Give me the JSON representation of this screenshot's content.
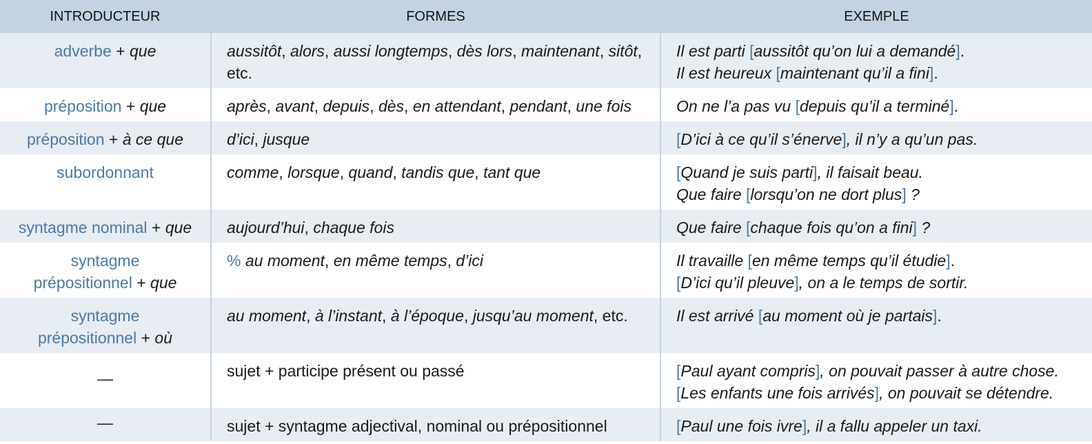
{
  "headers": [
    "INTRODUCTEUR",
    "FORMES",
    "EXEMPLE"
  ],
  "colors": {
    "accent": "#4a7aa4",
    "header_bg": "#c3d3e1",
    "row_alt_bg": "#e8edf3"
  },
  "rows": [
    {
      "intro": [
        {
          "t": "adverbe",
          "c": "blue"
        },
        {
          "t": " + ",
          "c": ""
        },
        {
          "t": "que",
          "c": "it"
        }
      ],
      "forms": [
        {
          "t": "aussitôt",
          "c": "it"
        },
        {
          "t": ", ",
          "c": ""
        },
        {
          "t": "alors",
          "c": "it"
        },
        {
          "t": ", ",
          "c": ""
        },
        {
          "t": "aussi longtemps",
          "c": "it"
        },
        {
          "t": ", ",
          "c": ""
        },
        {
          "t": "dès lors",
          "c": "it"
        },
        {
          "t": ", ",
          "c": ""
        },
        {
          "t": "maintenant",
          "c": "it"
        },
        {
          "t": ", ",
          "c": ""
        },
        {
          "t": "sitôt",
          "c": "it"
        },
        {
          "t": ", etc.",
          "c": ""
        }
      ],
      "examples": [
        [
          {
            "t": "Il est parti ",
            "c": "it"
          },
          {
            "t": "[",
            "c": "blue"
          },
          {
            "t": "aussitôt qu’on lui a demandé",
            "c": "it"
          },
          {
            "t": "]",
            "c": "blue"
          },
          {
            "t": ".",
            "c": ""
          }
        ],
        [
          {
            "t": "Il est heureux ",
            "c": "it"
          },
          {
            "t": "[",
            "c": "blue"
          },
          {
            "t": "maintenant qu’il a fini",
            "c": "it"
          },
          {
            "t": "]",
            "c": "blue"
          },
          {
            "t": ".",
            "c": ""
          }
        ]
      ],
      "alt": true
    },
    {
      "intro": [
        {
          "t": "préposition",
          "c": "blue"
        },
        {
          "t": " + ",
          "c": ""
        },
        {
          "t": "que",
          "c": "it"
        }
      ],
      "forms": [
        {
          "t": "après",
          "c": "it"
        },
        {
          "t": ", ",
          "c": ""
        },
        {
          "t": "avant",
          "c": "it"
        },
        {
          "t": ", ",
          "c": ""
        },
        {
          "t": "depuis",
          "c": "it"
        },
        {
          "t": ", ",
          "c": ""
        },
        {
          "t": "dès",
          "c": "it"
        },
        {
          "t": ", ",
          "c": ""
        },
        {
          "t": "en attendant",
          "c": "it"
        },
        {
          "t": ", ",
          "c": ""
        },
        {
          "t": "pendant",
          "c": "it"
        },
        {
          "t": ", ",
          "c": ""
        },
        {
          "t": "une fois",
          "c": "it"
        }
      ],
      "examples": [
        [
          {
            "t": "On ne l’a pas vu ",
            "c": "it"
          },
          {
            "t": "[",
            "c": "blue"
          },
          {
            "t": "depuis qu’il a terminé",
            "c": "it"
          },
          {
            "t": "]",
            "c": "blue"
          },
          {
            "t": ".",
            "c": ""
          }
        ]
      ],
      "alt": false
    },
    {
      "intro": [
        {
          "t": "préposition",
          "c": "blue"
        },
        {
          "t": " + ",
          "c": ""
        },
        {
          "t": "à ce que",
          "c": "it"
        }
      ],
      "forms": [
        {
          "t": "d’ici",
          "c": "it"
        },
        {
          "t": ", ",
          "c": ""
        },
        {
          "t": "jusque",
          "c": "it"
        }
      ],
      "examples": [
        [
          {
            "t": "[",
            "c": "blue"
          },
          {
            "t": "D’ici à ce qu’il s’énerve",
            "c": "it"
          },
          {
            "t": "]",
            "c": "blue"
          },
          {
            "t": ", il n’y a qu’un pas.",
            "c": "it"
          }
        ]
      ],
      "alt": true
    },
    {
      "intro": [
        {
          "t": "subordonnant",
          "c": "blue"
        }
      ],
      "forms": [
        {
          "t": "comme",
          "c": "it"
        },
        {
          "t": ", ",
          "c": ""
        },
        {
          "t": "lorsque",
          "c": "it"
        },
        {
          "t": ", ",
          "c": ""
        },
        {
          "t": "quand",
          "c": "it"
        },
        {
          "t": ", ",
          "c": ""
        },
        {
          "t": "tandis que",
          "c": "it"
        },
        {
          "t": ", ",
          "c": ""
        },
        {
          "t": "tant que",
          "c": "it"
        }
      ],
      "examples": [
        [
          {
            "t": "[",
            "c": "blue"
          },
          {
            "t": "Quand je suis parti",
            "c": "it"
          },
          {
            "t": "]",
            "c": "blue"
          },
          {
            "t": ", il faisait beau.",
            "c": "it"
          }
        ],
        [
          {
            "t": "Que faire ",
            "c": "it"
          },
          {
            "t": "[",
            "c": "blue"
          },
          {
            "t": "lorsqu’on ne dort plus",
            "c": "it"
          },
          {
            "t": "]",
            "c": "blue"
          },
          {
            "t": " ?",
            "c": "it"
          }
        ]
      ],
      "alt": false
    },
    {
      "intro": [
        {
          "t": "syntagme nominal",
          "c": "blue"
        },
        {
          "t": " + ",
          "c": ""
        },
        {
          "t": "que",
          "c": "it"
        }
      ],
      "forms": [
        {
          "t": "aujourd’hui",
          "c": "it"
        },
        {
          "t": ", ",
          "c": ""
        },
        {
          "t": "chaque fois",
          "c": "it"
        }
      ],
      "examples": [
        [
          {
            "t": "Que faire ",
            "c": "it"
          },
          {
            "t": "[",
            "c": "blue"
          },
          {
            "t": "chaque fois qu’on a fini",
            "c": "it"
          },
          {
            "t": "]",
            "c": "blue"
          },
          {
            "t": " ?",
            "c": "it"
          }
        ]
      ],
      "alt": true
    },
    {
      "intro": [
        {
          "t": "syntagme",
          "c": "blue",
          "br": true
        },
        {
          "t": "prépositionnel",
          "c": "blue"
        },
        {
          "t": " + ",
          "c": ""
        },
        {
          "t": "que",
          "c": "it"
        }
      ],
      "forms": [
        {
          "t": "%",
          "c": "blue"
        },
        {
          "t": " ",
          "c": ""
        },
        {
          "t": "au moment",
          "c": "it"
        },
        {
          "t": ", ",
          "c": ""
        },
        {
          "t": "en même temps",
          "c": "it"
        },
        {
          "t": ", ",
          "c": ""
        },
        {
          "t": "d’ici",
          "c": "it"
        }
      ],
      "examples": [
        [
          {
            "t": "Il travaille ",
            "c": "it"
          },
          {
            "t": "[",
            "c": "blue"
          },
          {
            "t": "en même temps qu’il étudie",
            "c": "it"
          },
          {
            "t": "]",
            "c": "blue"
          },
          {
            "t": ".",
            "c": ""
          }
        ],
        [
          {
            "t": "[",
            "c": "blue"
          },
          {
            "t": "D’ici qu’il pleuve",
            "c": "it"
          },
          {
            "t": "]",
            "c": "blue"
          },
          {
            "t": ", on a le temps de sortir.",
            "c": "it"
          }
        ]
      ],
      "alt": false
    },
    {
      "intro": [
        {
          "t": "syntagme",
          "c": "blue",
          "br": true
        },
        {
          "t": "prépositionnel",
          "c": "blue"
        },
        {
          "t": " + ",
          "c": ""
        },
        {
          "t": "où",
          "c": "it"
        }
      ],
      "forms": [
        {
          "t": "au moment",
          "c": "it"
        },
        {
          "t": ", ",
          "c": ""
        },
        {
          "t": "à l’instant",
          "c": "it"
        },
        {
          "t": ", ",
          "c": ""
        },
        {
          "t": "à l’époque",
          "c": "it"
        },
        {
          "t": ", ",
          "c": ""
        },
        {
          "t": "jusqu’au moment",
          "c": "it"
        },
        {
          "t": ", etc.",
          "c": ""
        }
      ],
      "examples": [
        [
          {
            "t": "Il est arrivé ",
            "c": "it"
          },
          {
            "t": "[",
            "c": "blue"
          },
          {
            "t": "au moment où je partais",
            "c": "it"
          },
          {
            "t": "]",
            "c": "blue"
          },
          {
            "t": ".",
            "c": ""
          }
        ]
      ],
      "alt": true
    },
    {
      "intro": [
        {
          "t": "—",
          "c": ""
        }
      ],
      "forms": [
        {
          "t": "sujet + participe présent ou passé",
          "c": ""
        }
      ],
      "examples": [
        [
          {
            "t": "[",
            "c": "blue"
          },
          {
            "t": "Paul ayant compris",
            "c": "it"
          },
          {
            "t": "]",
            "c": "blue"
          },
          {
            "t": ", on pouvait passer à autre chose.",
            "c": "it"
          }
        ],
        [
          {
            "t": "[",
            "c": "blue"
          },
          {
            "t": "Les enfants une fois arrivés",
            "c": "it"
          },
          {
            "t": "]",
            "c": "blue"
          },
          {
            "t": ", on pouvait se détendre.",
            "c": "it"
          }
        ]
      ],
      "alt": false,
      "intro_valign": "middle"
    },
    {
      "intro": [
        {
          "t": "—",
          "c": ""
        }
      ],
      "forms": [
        {
          "t": "sujet + syntagme adjectival, nominal ou prépositionnel",
          "c": ""
        }
      ],
      "examples": [
        [
          {
            "t": "[",
            "c": "blue"
          },
          {
            "t": "Paul une fois ivre",
            "c": "it"
          },
          {
            "t": "]",
            "c": "blue"
          },
          {
            "t": ", il a fallu appeler un taxi.",
            "c": "it"
          }
        ]
      ],
      "alt": true,
      "intro_valign": "middle"
    }
  ]
}
